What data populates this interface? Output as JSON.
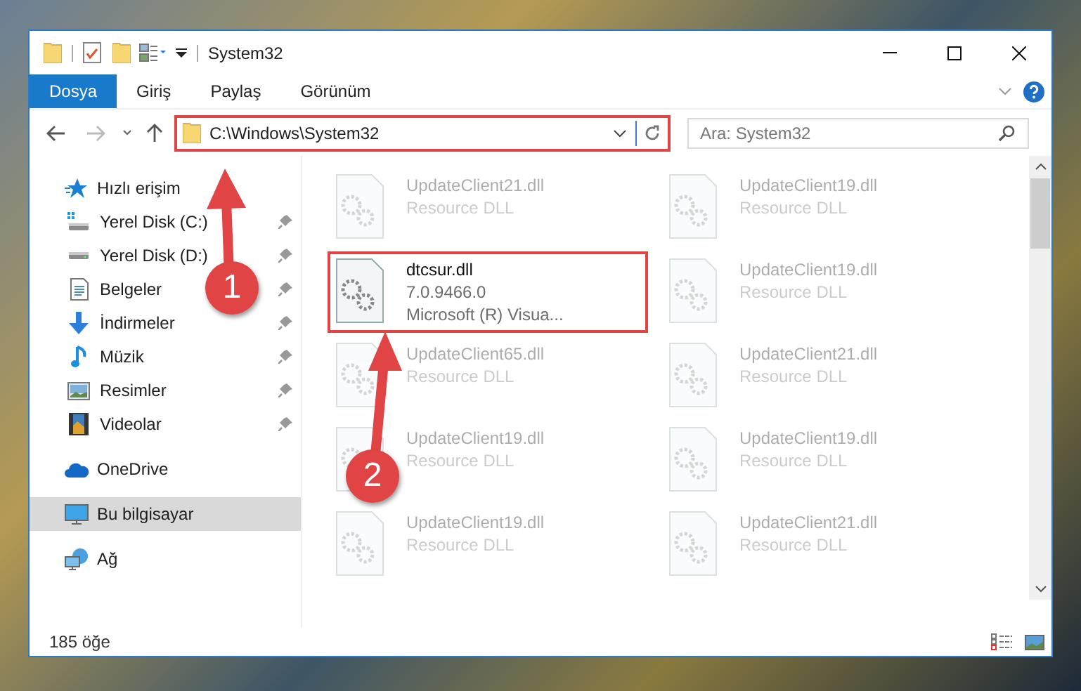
{
  "window": {
    "title": "System32"
  },
  "ribbon_tabs": [
    {
      "label": "Dosya",
      "selected": true
    },
    {
      "label": "Giriş",
      "selected": false
    },
    {
      "label": "Paylaş",
      "selected": false
    },
    {
      "label": "Görünüm",
      "selected": false
    }
  ],
  "address_bar": {
    "value": "C:\\Windows\\System32",
    "highlighted": true
  },
  "search": {
    "placeholder": "Ara: System32"
  },
  "sidebar": {
    "items": [
      {
        "label": "Hızlı erişim",
        "selected": false,
        "children": [
          {
            "label": "Yerel Disk (C:)",
            "selected": false,
            "pinned": true
          },
          {
            "label": "Yerel Disk (D:)",
            "selected": false,
            "pinned": true
          },
          {
            "label": "Belgeler",
            "selected": false,
            "pinned": true
          },
          {
            "label": "İndirmeler",
            "selected": false,
            "pinned": true
          },
          {
            "label": "Müzik",
            "selected": false,
            "pinned": true
          },
          {
            "label": "Resimler",
            "selected": false,
            "pinned": true
          },
          {
            "label": "Videolar",
            "selected": false,
            "pinned": true
          }
        ]
      },
      {
        "label": "OneDrive",
        "selected": false
      },
      {
        "label": "Bu bilgisayar",
        "selected": true
      },
      {
        "label": "Ağ",
        "selected": false
      }
    ]
  },
  "files": [
    {
      "name": "UpdateClient21.dll",
      "details": [
        "Resource DLL"
      ],
      "faded": true,
      "highlighted": false
    },
    {
      "name": "UpdateClient19.dll",
      "details": [
        "Resource DLL"
      ],
      "faded": true,
      "highlighted": false
    },
    {
      "name": "dtcsur.dll",
      "details": [
        "7.0.9466.0",
        "Microsoft (R) Visua..."
      ],
      "faded": false,
      "highlighted": true
    },
    {
      "name": "UpdateClient19.dll",
      "details": [
        "Resource DLL"
      ],
      "faded": true,
      "highlighted": false
    },
    {
      "name": "UpdateClient65.dll",
      "details": [
        "Resource DLL"
      ],
      "faded": true,
      "highlighted": false
    },
    {
      "name": "UpdateClient21.dll",
      "details": [
        "Resource DLL"
      ],
      "faded": true,
      "highlighted": false
    },
    {
      "name": "UpdateClient19.dll",
      "details": [
        "Resource DLL"
      ],
      "faded": true,
      "highlighted": false
    },
    {
      "name": "UpdateClient19.dll",
      "details": [
        "Resource DLL"
      ],
      "faded": true,
      "highlighted": false
    },
    {
      "name": "UpdateClient19.dll",
      "details": [
        "Resource DLL"
      ],
      "faded": true,
      "highlighted": false
    },
    {
      "name": "UpdateClient21.dll",
      "details": [
        "Resource DLL"
      ],
      "faded": true,
      "highlighted": false
    }
  ],
  "status_bar": {
    "count": "185 öğe"
  },
  "step_markers": [
    {
      "label": "1"
    },
    {
      "label": "2"
    }
  ]
}
